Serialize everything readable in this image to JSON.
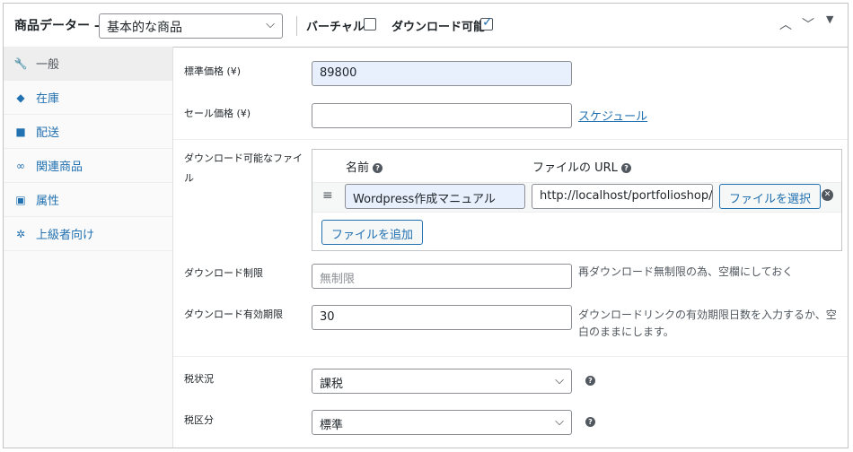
{
  "header": {
    "title": "商品データー —",
    "product_type": "基本的な商品",
    "virtual_label": "バーチャル:",
    "downloadable_label": "ダウンロード可能:",
    "virtual_checked": false,
    "downloadable_checked": true
  },
  "sidebar": {
    "items": [
      {
        "label": "一般",
        "icon": "wrench-icon",
        "active": true
      },
      {
        "label": "在庫",
        "icon": "tag-icon",
        "active": false
      },
      {
        "label": "配送",
        "icon": "truck-icon",
        "active": false
      },
      {
        "label": "関連商品",
        "icon": "link-icon",
        "active": false
      },
      {
        "label": "属性",
        "icon": "table-icon",
        "active": false
      },
      {
        "label": "上級者向け",
        "icon": "gear-icon",
        "active": false
      }
    ]
  },
  "general": {
    "regular_price_label": "標準価格 (¥)",
    "regular_price_value": "89800",
    "sale_price_label": "セール価格 (¥)",
    "sale_price_value": "",
    "schedule_link": "スケジュール",
    "files_label": "ダウンロード可能なファイル",
    "files_col_name": "名前",
    "files_col_url": "ファイルの URL",
    "file_name": "Wordpress作成マニュアル",
    "file_url": "http://localhost/portfolioshop/s",
    "choose_file_button": "ファイルを選択",
    "add_file_button": "ファイルを追加",
    "download_limit_label": "ダウンロード制限",
    "download_limit_placeholder": "無制限",
    "download_limit_help": "再ダウンロード無制限の為、空欄にしておく",
    "download_expiry_label": "ダウンロード有効期限",
    "download_expiry_value": "30",
    "download_expiry_help": "ダウンロードリンクの有効期限日数を入力するか、空白のままにします。",
    "tax_status_label": "税状況",
    "tax_status_value": "課税",
    "tax_class_label": "税区分",
    "tax_class_value": "標準"
  }
}
